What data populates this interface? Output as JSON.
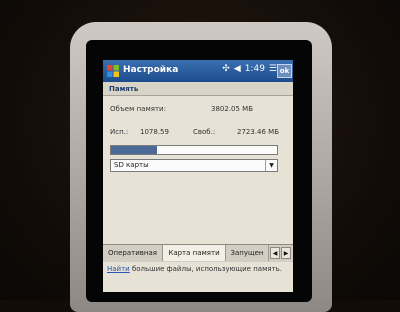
{
  "titlebar": {
    "title": "Настройка",
    "time": "1:49",
    "ok_label": "ok"
  },
  "section": {
    "title": "Память"
  },
  "memory": {
    "total_label": "Объем памяти:",
    "total_value": "3802.05 МБ",
    "used_label": "Исп.:",
    "used_value": "1078.59",
    "free_label": "Своб.:",
    "free_value": "2723.46 МБ",
    "used_fraction": 0.28
  },
  "storage_select": {
    "selected": "SD карты"
  },
  "tabs": [
    {
      "label": "Оперативная"
    },
    {
      "label": "Карта памяти"
    },
    {
      "label": "Запущен"
    }
  ],
  "footer": {
    "link": "Найти",
    "text": " большие файлы, использующие память."
  },
  "icons": {
    "start": "windows-flag-icon",
    "connectivity": "connectivity-icon",
    "volume": "speaker-icon",
    "menu": "menu-lines-icon",
    "dropdown": "chevron-down-icon",
    "tab_left": "arrow-left-icon",
    "tab_right": "arrow-right-icon"
  },
  "colors": {
    "titlebar": "#1c4c8c",
    "progress_fill": "#4b6a98",
    "link": "#2455b5"
  }
}
